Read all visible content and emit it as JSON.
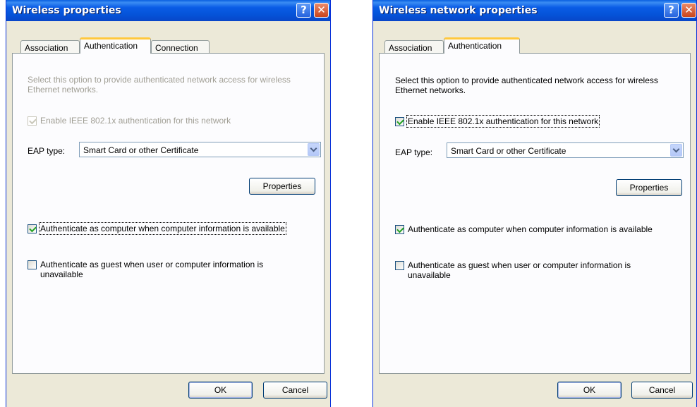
{
  "dialog1": {
    "title": "Wireless properties",
    "tabs": [
      "Association",
      "Authentication",
      "Connection"
    ],
    "description": "Select this option to provide authenticated network access for wireless Ethernet networks.",
    "enable_8021x_label": "Enable IEEE 802.1x authentication for this network",
    "enable_8021x_checked": true,
    "enable_8021x_disabled": true,
    "eap_label": "EAP type:",
    "eap_value": "Smart Card or other Certificate",
    "properties_label": "Properties",
    "auth_computer_label": "Authenticate as computer when computer information is available",
    "auth_computer_checked": true,
    "auth_guest_label": "Authenticate as guest when user or computer information is unavailable",
    "auth_guest_checked": false,
    "ok_label": "OK",
    "cancel_label": "Cancel"
  },
  "dialog2": {
    "title": "Wireless network properties",
    "tabs": [
      "Association",
      "Authentication"
    ],
    "description": "Select this option to provide authenticated network access for wireless Ethernet networks.",
    "enable_8021x_label": "Enable IEEE 802.1x authentication for this network",
    "enable_8021x_checked": true,
    "enable_8021x_disabled": false,
    "eap_label": "EAP type:",
    "eap_value": "Smart Card or other Certificate",
    "properties_label": "Properties",
    "auth_computer_label": "Authenticate as computer when computer information is available",
    "auth_computer_checked": true,
    "auth_guest_label": "Authenticate as guest when user or computer information is unavailable",
    "auth_guest_checked": false,
    "ok_label": "OK",
    "cancel_label": "Cancel"
  },
  "icons": {
    "help": "?",
    "close": "✕"
  },
  "colors": {
    "titlebar": "#0553d8",
    "dialog_bg": "#ece9d8",
    "tab_highlight": "#ffc83c",
    "check": "#21a121"
  }
}
